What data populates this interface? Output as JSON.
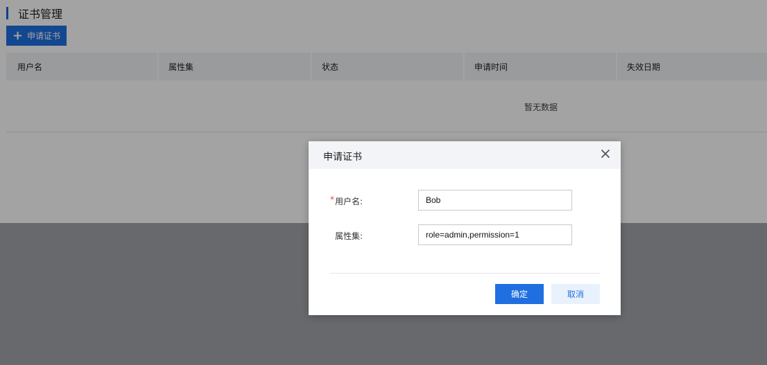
{
  "page": {
    "title": "证书管理",
    "apply_button_label": "申请证书",
    "apply_button_icon": "plus-icon"
  },
  "table": {
    "columns": [
      "用户名",
      "属性集",
      "状态",
      "申请时间",
      "失效日期"
    ],
    "empty_text": "暂无数据"
  },
  "dialog": {
    "title": "申请证书",
    "close_icon": "close-icon",
    "fields": [
      {
        "label": "用户名:",
        "required": true,
        "value": "Bob"
      },
      {
        "label": "属性集:",
        "required": false,
        "value": "role=admin,permission=1"
      }
    ],
    "ok_label": "确定",
    "cancel_label": "取消"
  },
  "colors": {
    "accent": "#1f6fe0",
    "required": "#e54545"
  }
}
